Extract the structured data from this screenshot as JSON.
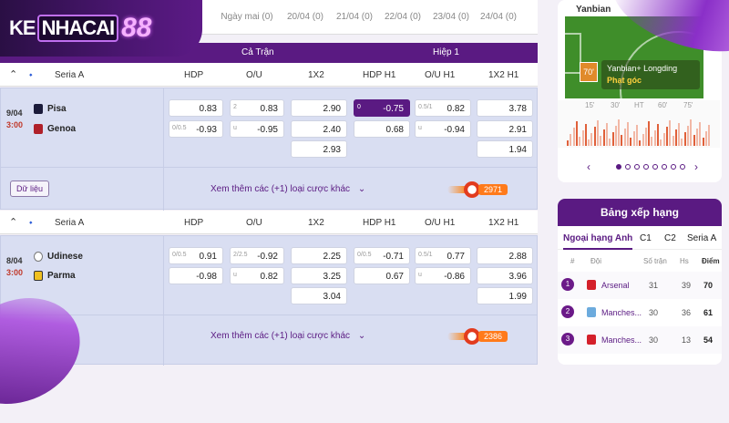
{
  "logo": {
    "part1": "KE",
    "part2": "NHACAI",
    "part3": "88"
  },
  "date_tabs": [
    "Ngày mai (0)",
    "20/04 (0)",
    "21/04 (0)",
    "22/04 (0)",
    "23/04 (0)",
    "24/04 (0)"
  ],
  "header": {
    "full_match": "Cả Trận",
    "half": "Hiệp 1"
  },
  "columns": [
    "HDP",
    "O/U",
    "1X2",
    "HDP H1",
    "O/U H1",
    "1X2 H1"
  ],
  "matches": [
    {
      "league": "Seria A",
      "date_fragment": "9/04",
      "time_fragment": "3:00",
      "home": "Pisa",
      "away": "Genoa",
      "odds": {
        "hdp": [
          {
            "s": "",
            "v": "0.83"
          },
          {
            "s": "0/0.5",
            "v": "-0.93"
          }
        ],
        "ou": [
          {
            "s": "2",
            "v": "0.83"
          },
          {
            "s": "u",
            "v": "-0.95"
          }
        ],
        "x12": [
          "2.90",
          "2.40",
          "2.93"
        ],
        "hdp_h1": [
          {
            "s": "0",
            "v": "-0.75"
          },
          {
            "s": "",
            "v": "0.68"
          }
        ],
        "ou_h1": [
          {
            "s": "0.5/1",
            "v": "0.82"
          },
          {
            "s": "u",
            "v": "-0.94"
          }
        ],
        "x12_h1": [
          "3.78",
          "2.91",
          "1.94"
        ]
      },
      "data_button": "Dữ liệu",
      "more_bets": "Xem thêm các (+1) loại cược khác",
      "hot_count": "2971"
    },
    {
      "league": "Seria A",
      "date_fragment": "8/04",
      "time_fragment": "3:00",
      "home": "Udinese",
      "away": "Parma",
      "odds": {
        "hdp": [
          {
            "s": "0/0.5",
            "v": "0.91"
          },
          {
            "s": "",
            "v": "-0.98"
          }
        ],
        "ou": [
          {
            "s": "2/2.5",
            "v": "-0.92"
          },
          {
            "s": "u",
            "v": "0.82"
          }
        ],
        "x12": [
          "2.25",
          "3.25",
          "3.04"
        ],
        "hdp_h1": [
          {
            "s": "0/0.5",
            "v": "-0.71"
          },
          {
            "s": "",
            "v": "0.67"
          }
        ],
        "ou_h1": [
          {
            "s": "0.5/1",
            "v": "0.77"
          },
          {
            "s": "u",
            "v": "-0.86"
          }
        ],
        "x12_h1": [
          "2.88",
          "3.96",
          "1.99"
        ]
      },
      "more_bets": "Xem thêm các (+1) loại cược khác",
      "hot_count": "2386"
    }
  ],
  "live": {
    "top_text": "Yanbian",
    "minute": "70'",
    "event_teams": "Yanbian+ Longding",
    "event_label": "Phạt góc",
    "timeline_ticks": [
      "15'",
      "30'",
      "HT",
      "60'",
      "75'"
    ],
    "dots_count": 8,
    "active_dot": 0
  },
  "ranking": {
    "title": "Bảng xếp hạng",
    "tabs": [
      "Ngoại hạng Anh",
      "C1",
      "C2",
      "Seria A"
    ],
    "active_tab": 0,
    "columns": [
      "#",
      "Đội",
      "Số trận",
      "Hs",
      "Điểm"
    ],
    "rows": [
      {
        "rank": "1",
        "team": "Arsenal",
        "played": "31",
        "gd": "39",
        "pts": "70",
        "color": "#6b1a88"
      },
      {
        "rank": "2",
        "team": "Manches...",
        "played": "30",
        "gd": "36",
        "pts": "61",
        "color": "#6b1a88"
      },
      {
        "rank": "3",
        "team": "Manches...",
        "played": "30",
        "gd": "13",
        "pts": "54",
        "color": "#6b1a88"
      }
    ]
  },
  "colors": {
    "brand": "#5a1a82",
    "accent": "#ff7a1a",
    "row_bg": "#d9def2"
  }
}
